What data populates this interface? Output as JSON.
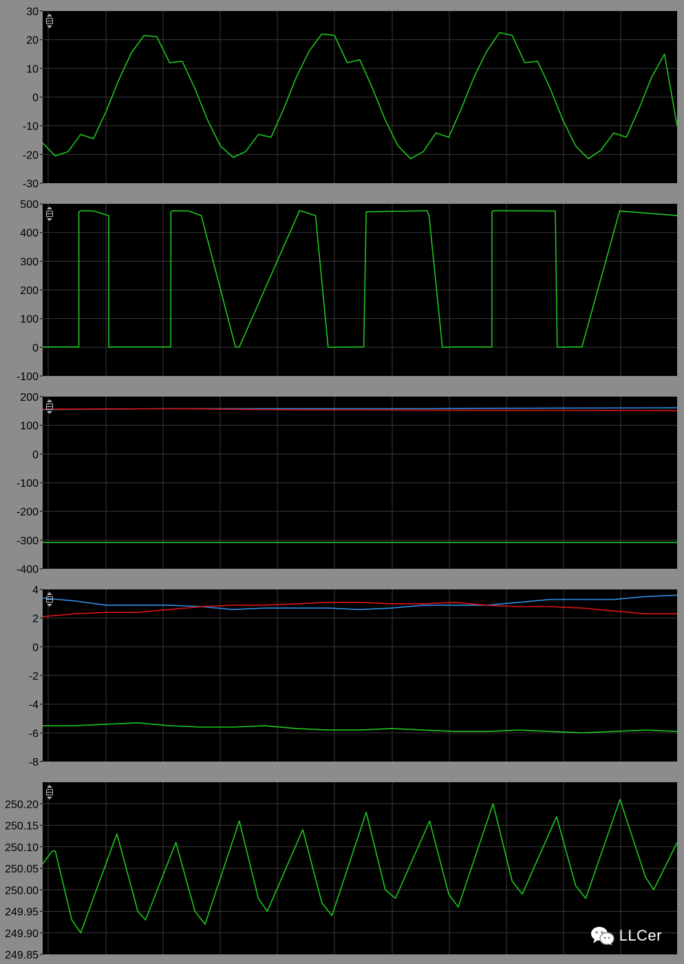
{
  "colors": {
    "background": "#8c8c8c",
    "plot_bg": "#000000",
    "grid": "#3a3a3a",
    "green": "#1ec81e",
    "red": "#e01414",
    "blue": "#2f8fe8"
  },
  "watermark": {
    "text": "LLCer",
    "icon": "wechat-icon"
  },
  "chart_data": [
    {
      "type": "line",
      "ylim": [
        -30,
        30
      ],
      "yticks": [
        "30",
        "20",
        "10",
        "0",
        "-10",
        "-20",
        "-30"
      ],
      "grid": true,
      "x": [
        0,
        2,
        4,
        6,
        8,
        10,
        12,
        14,
        16,
        18,
        20,
        22,
        24,
        26,
        28,
        30,
        32,
        34,
        36,
        38,
        40,
        42,
        44,
        46,
        48,
        50,
        52,
        54,
        56,
        58,
        60,
        62,
        64,
        66,
        68,
        70,
        72,
        74,
        76,
        78,
        80,
        82,
        84,
        86,
        88,
        90,
        92,
        94,
        96,
        98,
        100
      ],
      "series": [
        {
          "color": "#1ec81e",
          "values": [
            -16,
            -20.5,
            -19,
            -13,
            -14.5,
            -5,
            6,
            15.5,
            21.5,
            21,
            12,
            12.5,
            3,
            -8,
            -17,
            -21,
            -19,
            -13,
            -14,
            -4,
            7,
            16,
            22,
            21.5,
            12,
            13,
            3,
            -8,
            -17,
            -21.5,
            -19,
            -12.5,
            -14,
            -4,
            7,
            16,
            22.5,
            21.5,
            12,
            12.5,
            3,
            -8,
            -17,
            -21.5,
            -18.5,
            -12.5,
            -14,
            -4,
            7,
            15,
            -10
          ]
        }
      ]
    },
    {
      "type": "line",
      "ylim": [
        -100,
        500
      ],
      "yticks": [
        "500",
        "400",
        "300",
        "200",
        "100",
        "0",
        "-100"
      ],
      "grid": true,
      "x": [
        0,
        5.7,
        5.71,
        6,
        8,
        10.4,
        10.41,
        11,
        20.2,
        20.21,
        20.5,
        23,
        25,
        30.4,
        30.41,
        31,
        40.4,
        40.41,
        40.7,
        43,
        45,
        50.6,
        50.61,
        51,
        60.6,
        60.61,
        60.9,
        63,
        65,
        70.8,
        70.81,
        71,
        80.8,
        80.81,
        81.1,
        83,
        85,
        90.9,
        90.91,
        91,
        100
      ],
      "series": [
        {
          "color": "#1ec81e",
          "values": [
            1,
            1,
            472,
            476,
            475,
            459,
            0,
            1,
            1,
            472,
            476,
            475,
            459,
            0,
            1,
            1,
            472,
            476,
            475,
            459,
            0,
            1,
            1,
            472,
            476,
            475,
            459,
            0,
            1,
            1,
            472,
            476,
            475,
            459,
            0,
            1,
            1,
            472,
            476,
            475,
            459
          ]
        }
      ]
    },
    {
      "type": "line",
      "ylim": [
        -400,
        200
      ],
      "yticks": [
        "200",
        "100",
        "0",
        "-100",
        "-200",
        "-300",
        "-400"
      ],
      "grid": true,
      "x": [
        0,
        20,
        40,
        60,
        80,
        100
      ],
      "series": [
        {
          "color": "#2f8fe8",
          "values": [
            155,
            158,
            158,
            158,
            160,
            161
          ]
        },
        {
          "color": "#e01414",
          "values": [
            156,
            158,
            154,
            153,
            152,
            151
          ]
        },
        {
          "color": "#1ec81e",
          "values": [
            -308,
            -308,
            -308,
            -308,
            -308,
            -308
          ]
        }
      ]
    },
    {
      "type": "line",
      "ylim": [
        -8,
        4
      ],
      "yticks": [
        "4",
        "2",
        "0",
        "-2",
        "-4",
        "-6",
        "-8"
      ],
      "grid": true,
      "x": [
        0,
        5,
        10,
        15,
        20,
        25,
        30,
        35,
        40,
        45,
        50,
        55,
        60,
        65,
        70,
        75,
        80,
        85,
        90,
        95,
        100
      ],
      "series": [
        {
          "color": "#2f8fe8",
          "values": [
            3.4,
            3.2,
            2.9,
            2.9,
            2.9,
            2.8,
            2.6,
            2.7,
            2.7,
            2.7,
            2.6,
            2.7,
            2.9,
            2.9,
            2.9,
            3.1,
            3.3,
            3.3,
            3.3,
            3.5,
            3.6
          ]
        },
        {
          "color": "#e01414",
          "values": [
            2.1,
            2.3,
            2.4,
            2.4,
            2.6,
            2.8,
            2.9,
            2.9,
            3.0,
            3.1,
            3.1,
            3.0,
            3.0,
            3.1,
            2.9,
            2.8,
            2.8,
            2.7,
            2.5,
            2.3,
            2.3
          ]
        },
        {
          "color": "#1ec81e",
          "values": [
            -5.5,
            -5.5,
            -5.4,
            -5.3,
            -5.5,
            -5.6,
            -5.6,
            -5.5,
            -5.7,
            -5.8,
            -5.8,
            -5.7,
            -5.8,
            -5.9,
            -5.9,
            -5.8,
            -5.9,
            -6.0,
            -5.9,
            -5.8,
            -5.9
          ]
        }
      ]
    },
    {
      "type": "line",
      "ylim": [
        249.85,
        250.25
      ],
      "yticks": [
        "250.20",
        "250.15",
        "250.10",
        "250.05",
        "250.00",
        "249.95",
        "249.90",
        "249.85"
      ],
      "grid": true,
      "x": [
        0,
        1.5,
        2,
        4.6,
        6,
        11.7,
        15,
        16.2,
        21,
        24,
        25.6,
        31,
        34,
        35.4,
        41,
        44,
        45.6,
        51,
        54,
        55.6,
        61,
        64,
        65.5,
        71,
        74,
        75.6,
        81,
        84,
        85.6,
        91,
        95,
        96.3,
        100
      ],
      "series": [
        {
          "color": "#1ec81e",
          "values": [
            250.06,
            250.09,
            250.09,
            249.93,
            249.9,
            250.13,
            249.95,
            249.93,
            250.11,
            249.95,
            249.92,
            250.16,
            249.98,
            249.95,
            250.14,
            249.97,
            249.94,
            250.18,
            250.0,
            249.98,
            250.16,
            249.99,
            249.96,
            250.2,
            250.02,
            249.99,
            250.17,
            250.01,
            249.98,
            250.21,
            250.03,
            250.0,
            250.11
          ]
        }
      ]
    }
  ]
}
